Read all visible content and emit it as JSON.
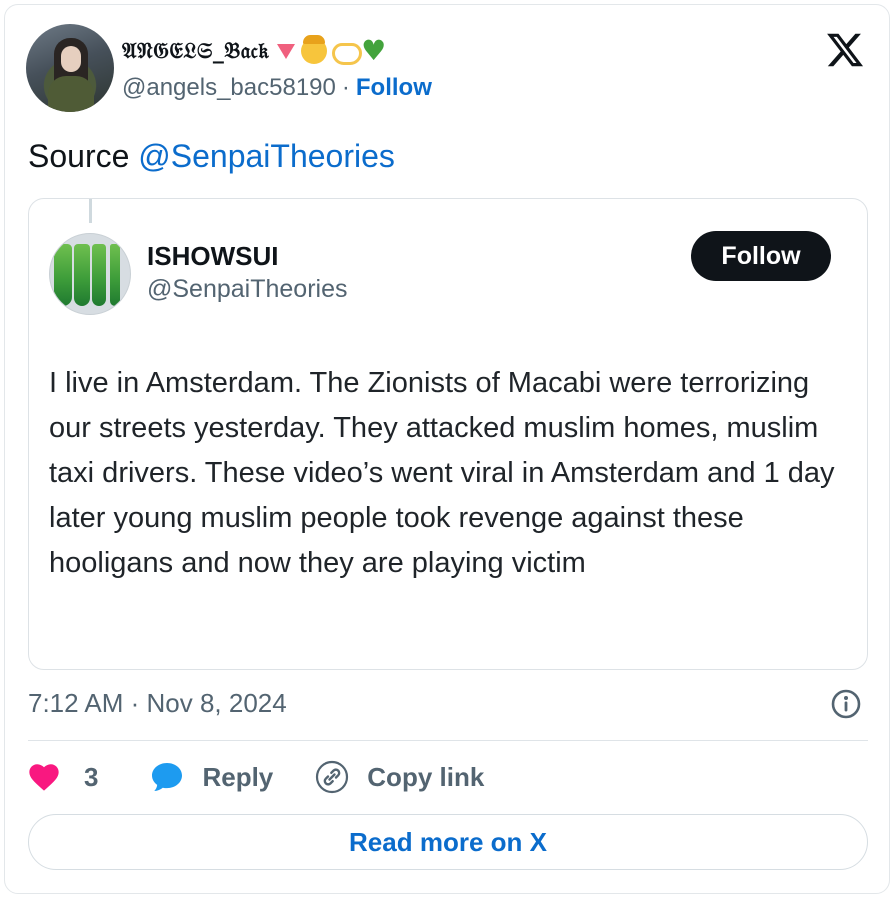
{
  "author": {
    "display_name": "𝔄𝔑𝔊𝔈𝔏𝔖_𝔅𝔞𝔠𝔨",
    "handle": "@angels_bac58190",
    "separator": "·",
    "follow_label": "Follow"
  },
  "tweet": {
    "text_prefix": "Source ",
    "mention": "@SenpaiTheories"
  },
  "quote": {
    "name": "ISHOWSUI",
    "handle": "@SenpaiTheories",
    "follow_label": "Follow",
    "body": "I live in Amsterdam. The Zionists of Macabi were terrorizing our streets yesterday. They attacked muslim homes, muslim taxi drivers. These video’s went viral in Amsterdam and 1 day later young muslim people took revenge against these hooligans and now they are playing victim"
  },
  "meta": {
    "timestamp": "7:12 AM · Nov 8, 2024"
  },
  "actions": {
    "like_count": "3",
    "reply_label": "Reply",
    "copy_link_label": "Copy link"
  },
  "footer": {
    "read_more_label": "Read more on X"
  },
  "icons": {
    "header_logo": "x-logo-icon",
    "info": "info-icon",
    "like": "heart-icon",
    "reply": "speech-bubble-icon",
    "copy": "link-icon"
  },
  "colors": {
    "link_blue": "#0b6ccc",
    "heart_pink": "#f91880",
    "reply_blue": "#1d9bf0",
    "text_dark": "#0f1419",
    "text_muted": "#536471"
  }
}
